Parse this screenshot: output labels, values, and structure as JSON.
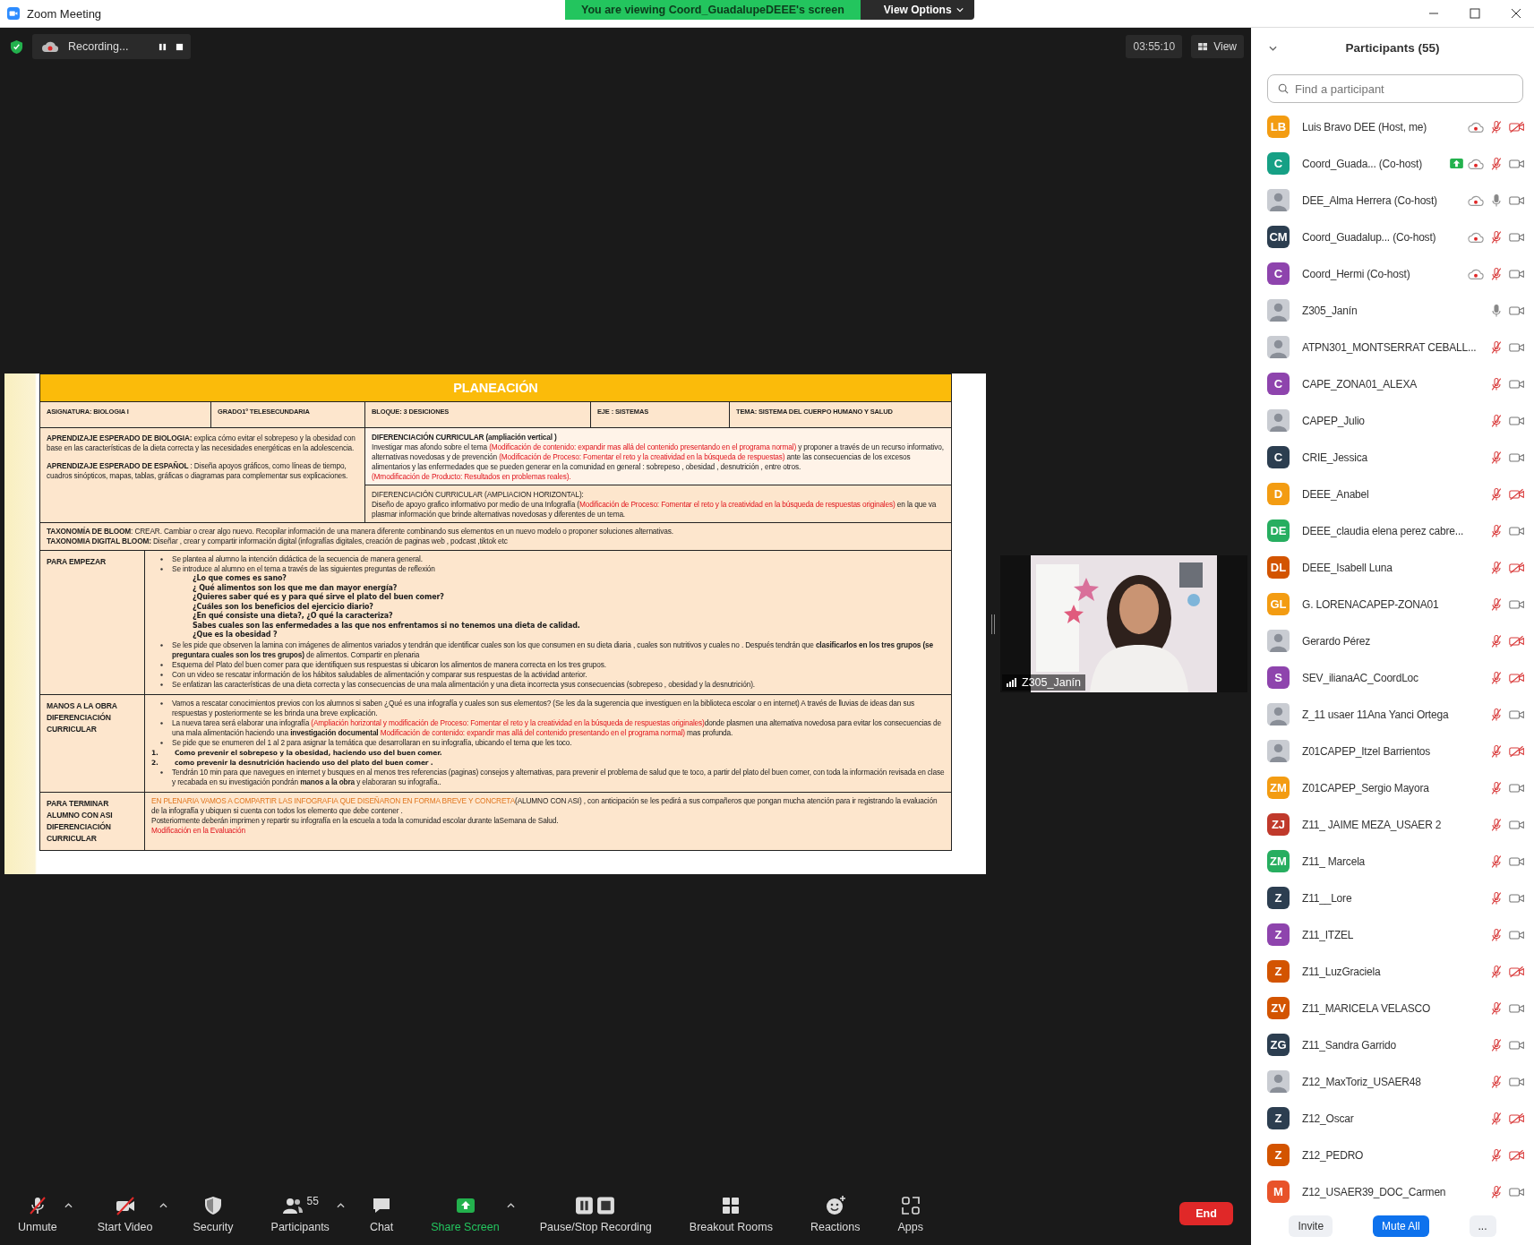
{
  "window": {
    "title": "Zoom Meeting"
  },
  "banner": {
    "text": "You are viewing Coord_GuadalupeDEEE's screen",
    "options": "View Options"
  },
  "top_bar": {
    "recording": "Recording...",
    "timer": "03:55:10",
    "view": "View"
  },
  "document": {
    "title": "PLANEACIÓN",
    "info": [
      "ASIGNATURA: BIOLOGIA I",
      "GRADO1º TELESECUNDARIA",
      "BLOQUE: 3  DESICIONES",
      "EJE : SISTEMAS",
      "TEMA: SISTEMA DEL CUERPO HUMANO Y SALUD"
    ],
    "left_block": [
      {
        "segments": [
          {
            "kind": "plain",
            "text": "**APRENDIZAJE ESPERADO DE BIOLOGIA:** explica cómo evitar el sobrepeso y la obesidad con base en las características de la dieta correcta y las necesidades energéticas en la adolescencia."
          }
        ]
      },
      {
        "segments": [
          {
            "kind": "plain",
            "text": "**APRENDIZAJE ESPERADO DE ESPAÑOL** : Diseña apoyos gráficos, como líneas de tiempo, cuadros sinópticos, mapas, tablas, gráficas o diagramas para complementar sus explicaciones."
          }
        ]
      }
    ],
    "right_blocks": [
      [
        {
          "segments": [
            {
              "kind": "plain",
              "text": "**DIFERENCIACIÓN CURRICULAR (ampliación vertical )**"
            }
          ]
        },
        {
          "segments": [
            {
              "kind": "plain",
              "text": "Investigar mas afondo sobre el tema "
            },
            {
              "kind": "red",
              "text": "(Modificación de contenido: expandir mas allá del contenido presentando en el programa normal)"
            },
            {
              "kind": "plain",
              "text": " y proponer  a través de un recurso informativo, alternativas novedosas y de prevención  "
            },
            {
              "kind": "red",
              "text": "(Modificación de Proceso: Fomentar el reto y la creatividad en la búsqueda de respuestas)"
            },
            {
              "kind": "plain",
              "text": "  ante las consecuencias de los excesos alimentarios  y las enfermedades que se pueden generar en la comunidad en general  : sobrepeso , obesidad , desnutrición , entre otros."
            }
          ]
        },
        {
          "segments": [
            {
              "kind": "red",
              "text": "(Mmodificación de Producto: Resultados en problemas reales)."
            }
          ]
        }
      ],
      [
        {
          "segments": [
            {
              "kind": "plain",
              "text": "DIFERENCIACIÓN CURRICULAR (AMPLIACION HORIZONTAL):"
            }
          ]
        },
        {
          "segments": [
            {
              "kind": "plain",
              "text": "Diseño de apoyo grafico informativo por medio de una Infografía ("
            },
            {
              "kind": "red",
              "text": "Modificación de Proceso: Fomentar el reto y la creatividad en la búsqueda de respuestas originales)"
            },
            {
              "kind": "plain",
              "text": " en la que va  plasmar información  que brinde  alternativas novedosas y diferentes de un tema."
            }
          ]
        }
      ]
    ],
    "taxonomy": [
      "**TAXONOMÍA DE BLOOM**: CREAR. Cambiar o crear algo nuevo. Recopilar información de una manera diferente combinando sus elementos en un nuevo modelo o proponer soluciones alternativas.",
      "**TAXONOMIA DIGITAL BLOOM:** Diseñar , crear  y compartir información digital (infografías digitales, creación de paginas web , podcast ,tiktok etc"
    ],
    "sections": [
      {
        "label": [
          "PARA EMPEZAR"
        ],
        "items": [
          {
            "kind": "bullet",
            "segments": [
              {
                "kind": "plain",
                "text": "Se plantea al alumno la intención didáctica de la secuencia de manera general."
              }
            ]
          },
          {
            "kind": "bullet",
            "segments": [
              {
                "kind": "plain",
                "text": "Se introduce  al alumno en el  tema a través de las siguientes  preguntas de reflexión"
              }
            ]
          },
          {
            "kind": "question",
            "segments": [
              {
                "kind": "plain",
                "text": "¿Lo que comes es sano?"
              }
            ]
          },
          {
            "kind": "question",
            "segments": [
              {
                "kind": "plain",
                "text": "¿ Qué alimentos son los que me dan mayor energía?"
              }
            ]
          },
          {
            "kind": "question",
            "segments": [
              {
                "kind": "plain",
                "text": "¿Quieres saber qué es y para qué sirve el plato del buen comer?"
              }
            ]
          },
          {
            "kind": "question",
            "segments": [
              {
                "kind": "plain",
                "text": "¿Cuáles son los beneficios del ejercicio diario?"
              }
            ]
          },
          {
            "kind": "question",
            "segments": [
              {
                "kind": "plain",
                "text": "¿En qué consiste una dieta?, ¿O qué la caracteriza?"
              }
            ]
          },
          {
            "kind": "question",
            "segments": [
              {
                "kind": "plain",
                "text": "Sabes cuales son las enfermedades a las que nos enfrentamos si no tenemos una dieta de calidad."
              }
            ]
          },
          {
            "kind": "question",
            "segments": [
              {
                "kind": "plain",
                "text": "¿Que es la obesidad ?"
              }
            ]
          },
          {
            "kind": "bullet",
            "segments": [
              {
                "kind": "plain",
                "text": "Se les pide que observen la lamina con imágenes de alimentos variados y tendrán que identificar cuales son los  que consumen en su dieta diaria , cuales son nutritivos y cuales no . Después tendrán que **clasificarlos en los tres grupos (se preguntara cuales son los tres grupos)** de alimentos. Compartir en plenaria"
              }
            ]
          },
          {
            "kind": "bullet",
            "segments": [
              {
                "kind": "plain",
                "text": "Esquema del Plato del buen comer para que identifiquen sus respuestas  si ubicaron los alimentos de manera correcta en los tres grupos."
              }
            ]
          },
          {
            "kind": "bullet",
            "segments": [
              {
                "kind": "plain",
                "text": "Con un  video se rescatar información de los hábitos saludables de alimentación  y comparar sus respuestas de la actividad anterior."
              }
            ]
          },
          {
            "kind": "bullet",
            "segments": [
              {
                "kind": "plain",
                "text": "Se enfatizan las características de una dieta correcta y las consecuencias de una mala alimentación y una dieta incorrecta  ysus consecuencias (sobrepeso , obesidad y la desnutrición)."
              }
            ]
          }
        ]
      },
      {
        "label": [
          "MANOS A LA OBRA",
          "DIFERENCIACIÓN",
          "CURRICULAR"
        ],
        "items": [
          {
            "kind": "bullet",
            "segments": [
              {
                "kind": "plain",
                "text": "Vamos a rescatar conocimientos previos con  los alumnos  si saben ¿Qué es una infografía y cuales son sus elementos? (Se les da la sugerencia que investiguen  en  la biblioteca escolar  o en internet)  A través de lluvias de ideas dan sus respuestas y posteriormente se les brinda  una breve explicación."
              }
            ]
          },
          {
            "kind": "bullet",
            "segments": [
              {
                "kind": "plain",
                "text": "La nueva tarea será  elaborar una infografía "
              },
              {
                "kind": "red",
                "text": "(Ampliación horizontal y modificación de Proceso: Fomentar el reto y la creatividad en la búsqueda de respuestas originales)"
              },
              {
                "kind": "plain",
                "text": "donde plasmen una alternativa novedosa para evitar los consecuencias de una mala alimentación haciendo una **investigación documental** "
              },
              {
                "kind": "red",
                "text": "Modificación de contenido: expandir mas allá del contenido presentando en el programa normal)"
              },
              {
                "kind": "plain",
                "text": " mas profunda."
              }
            ]
          },
          {
            "kind": "bullet",
            "segments": [
              {
                "kind": "plain",
                "text": "Se  pide que se enumeren del 1 al 2 para asignar  la temática que desarrollaran en su infografía, ubicando el tema que les toco."
              }
            ]
          },
          {
            "kind": "numbered",
            "number": "1.",
            "segments": [
              {
                "kind": "plain",
                "text": "Como prevenir el sobrepeso y la obesidad, haciendo uso del buen comer."
              }
            ]
          },
          {
            "kind": "numbered",
            "number": "2.",
            "segments": [
              {
                "kind": "plain",
                "text": "como prevenir la desnutrición haciendo uso del plato del  buen comer ."
              }
            ]
          },
          {
            "kind": "bullet",
            "segments": [
              {
                "kind": "plain",
                "text": "Tendrán  10 min para que navegues en internet  y busques en al menos tres referencias (paginas) consejos y alternativas,  para prevenir el problema de salud que te toco, a partir del plato del  buen comer, con toda la información revisada en clase y  recabada  en su investigación pondrán **manos a la obra** y elaboraran su infografía.."
              }
            ]
          }
        ]
      },
      {
        "label": [
          "PARA TERMINAR",
          "ALUMNO CON ASI",
          "DIFERENCIACIÓN",
          "CURRICULAR"
        ],
        "items": [
          {
            "kind": "para",
            "segments": [
              {
                "kind": "orange",
                "text": "EN PLENARIA VAMOS A COMPARTIR LAS INFOGRAFIA QUE DISEÑARON EN FORMA BREVE Y CONCRETA"
              },
              {
                "kind": "plain",
                "text": "(ALUMNO CON ASI)  , con anticipación se les pedirá a sus compañeros que pongan mucha atención para ir registrando  la evaluación de la  infografía y ubiquen si cuenta  con todos los elemento que debe contener ."
              }
            ]
          },
          {
            "kind": "para",
            "segments": [
              {
                "kind": "plain",
                "text": "Posteriormente deberán  imprimen y repartir  su infografía  en la escuela a toda la comunidad escolar  durante laSemana de Salud."
              }
            ]
          },
          {
            "kind": "para",
            "segments": [
              {
                "kind": "red",
                "text": "Modificación en la Evaluación"
              }
            ]
          }
        ]
      }
    ]
  },
  "video_tile": {
    "kind": "picture",
    "name": "Z305_Janín"
  },
  "toolbar": [
    {
      "kind": "mic",
      "label": "Unmute",
      "caret": true
    },
    {
      "kind": "video",
      "label": "Start Video",
      "caret": true
    },
    {
      "kind": "security",
      "label": "Security",
      "caret": false
    },
    {
      "kind": "participants",
      "label": "Participants",
      "count": "55",
      "caret": true
    },
    {
      "kind": "chat",
      "label": "Chat",
      "caret": false
    },
    {
      "kind": "share",
      "label": "Share Screen",
      "caret": true
    },
    {
      "kind": "record",
      "label": "Pause/Stop Recording",
      "caret": false
    },
    {
      "kind": "breakout",
      "label": "Breakout Rooms",
      "caret": false
    },
    {
      "kind": "reactions",
      "label": "Reactions",
      "caret": false
    },
    {
      "kind": "apps",
      "label": "Apps",
      "caret": false
    }
  ],
  "end_button": "End",
  "participants": {
    "title": "Participants (55)",
    "search": {
      "placeholder": "Find a participant"
    },
    "list": [
      {
        "avatar": {
          "kind": "initials",
          "initials": "LB",
          "color": "#f39c12"
        },
        "name": "Luis Bravo DEE (Host, me)",
        "recording": true,
        "sharing": false,
        "muted": true,
        "video_off": true
      },
      {
        "avatar": {
          "kind": "initials",
          "initials": "C",
          "color": "#16a085"
        },
        "name": "Coord_Guada... (Co-host)",
        "recording": true,
        "sharing": true,
        "muted": true,
        "video_off": false
      },
      {
        "name": "DEE_Alma Herrera (Co-host)",
        "recording": true,
        "sharing": false,
        "muted": false,
        "video_off": false
      },
      {
        "avatar": {
          "kind": "initials",
          "initials": "CM",
          "color": "#2c3e50"
        },
        "name": "Coord_Guadalup...   (Co-host)",
        "recording": true,
        "sharing": false,
        "muted": true,
        "video_off": false
      },
      {
        "avatar": {
          "kind": "initials",
          "initials": "C",
          "color": "#8e44ad"
        },
        "name": "Coord_Hermi (Co-host)",
        "recording": true,
        "sharing": false,
        "muted": true,
        "video_off": false
      },
      {
        "name": "Z305_Janín",
        "recording": false,
        "sharing": false,
        "muted": false,
        "video_off": false
      },
      {
        "name": "ATPN301_MONTSERRAT CEBALL...",
        "recording": false,
        "sharing": false,
        "muted": true,
        "video_off": false
      },
      {
        "avatar": {
          "kind": "initials",
          "initials": "C",
          "color": "#8e44ad"
        },
        "name": "CAPE_ZONA01_ALEXA",
        "recording": false,
        "sharing": false,
        "muted": true,
        "video_off": false
      },
      {
        "name": "CAPEP_Julio",
        "recording": false,
        "sharing": false,
        "muted": true,
        "video_off": false
      },
      {
        "avatar": {
          "kind": "initials",
          "initials": "C",
          "color": "#2c3e50"
        },
        "name": "CRIE_Jessica",
        "recording": false,
        "sharing": false,
        "muted": true,
        "video_off": false
      },
      {
        "avatar": {
          "kind": "initials",
          "initials": "D",
          "color": "#f39c12"
        },
        "name": "DEEE_Anabel",
        "recording": false,
        "sharing": false,
        "muted": true,
        "video_off": true
      },
      {
        "avatar": {
          "kind": "initials",
          "initials": "DE",
          "color": "#27ae60"
        },
        "name": "DEEE_claudia elena perez cabre...",
        "recording": false,
        "sharing": false,
        "muted": true,
        "video_off": false
      },
      {
        "avatar": {
          "kind": "initials",
          "initials": "DL",
          "color": "#d35400"
        },
        "name": "DEEE_Isabell Luna",
        "recording": false,
        "sharing": false,
        "muted": true,
        "video_off": true
      },
      {
        "avatar": {
          "kind": "initials",
          "initials": "GL",
          "color": "#f39c12"
        },
        "name": "G. LORENACAPEP-ZONA01",
        "recording": false,
        "sharing": false,
        "muted": true,
        "video_off": false
      },
      {
        "name": "Gerardo Pérez",
        "recording": false,
        "sharing": false,
        "muted": true,
        "video_off": true
      },
      {
        "avatar": {
          "kind": "initials",
          "initials": "S",
          "color": "#8e44ad"
        },
        "name": "SEV_ilianaAC_CoordLoc",
        "recording": false,
        "sharing": false,
        "muted": true,
        "video_off": true
      },
      {
        "name": "Z_11 usaer 11Ana Yanci Ortega",
        "recording": false,
        "sharing": false,
        "muted": true,
        "video_off": false
      },
      {
        "name": "Z01CAPEP_Itzel Barrientos",
        "recording": false,
        "sharing": false,
        "muted": true,
        "video_off": true
      },
      {
        "avatar": {
          "kind": "initials",
          "initials": "ZM",
          "color": "#f39c12"
        },
        "name": "Z01CAPEP_Sergio Mayora",
        "recording": false,
        "sharing": false,
        "muted": true,
        "video_off": false
      },
      {
        "avatar": {
          "kind": "initials",
          "initials": "ZJ",
          "color": "#c0392b"
        },
        "name": "Z11_ JAIME MEZA_USAER 2",
        "recording": false,
        "sharing": false,
        "muted": true,
        "video_off": false
      },
      {
        "avatar": {
          "kind": "initials",
          "initials": "ZM",
          "color": "#27ae60"
        },
        "name": "Z11_ Marcela",
        "recording": false,
        "sharing": false,
        "muted": true,
        "video_off": false
      },
      {
        "avatar": {
          "kind": "initials",
          "initials": "Z",
          "color": "#2c3e50"
        },
        "name": "Z11__Lore",
        "recording": false,
        "sharing": false,
        "muted": true,
        "video_off": false
      },
      {
        "avatar": {
          "kind": "initials",
          "initials": "Z",
          "color": "#8e44ad"
        },
        "name": "Z11_ITZEL",
        "recording": false,
        "sharing": false,
        "muted": true,
        "video_off": false
      },
      {
        "avatar": {
          "kind": "initials",
          "initials": "Z",
          "color": "#d35400"
        },
        "name": "Z11_LuzGraciela",
        "recording": false,
        "sharing": false,
        "muted": true,
        "video_off": true
      },
      {
        "avatar": {
          "kind": "initials",
          "initials": "ZV",
          "color": "#d35400"
        },
        "name": "Z11_MARICELA VELASCO",
        "recording": false,
        "sharing": false,
        "muted": true,
        "video_off": false
      },
      {
        "avatar": {
          "kind": "initials",
          "initials": "ZG",
          "color": "#2c3e50"
        },
        "name": "Z11_Sandra Garrido",
        "recording": false,
        "sharing": false,
        "muted": true,
        "video_off": false
      },
      {
        "name": "Z12_MaxToriz_USAER48",
        "recording": false,
        "sharing": false,
        "muted": true,
        "video_off": false
      },
      {
        "avatar": {
          "kind": "initials",
          "initials": "Z",
          "color": "#2c3e50"
        },
        "name": "Z12_Oscar",
        "recording": false,
        "sharing": false,
        "muted": true,
        "video_off": true
      },
      {
        "avatar": {
          "kind": "initials",
          "initials": "Z",
          "color": "#d35400"
        },
        "name": "Z12_PEDRO",
        "recording": false,
        "sharing": false,
        "muted": true,
        "video_off": true
      },
      {
        "avatar": {
          "kind": "initials",
          "initials": "M",
          "color": "#e8532a"
        },
        "name": "Z12_USAER39_DOC_Carmen",
        "recording": false,
        "sharing": false,
        "muted": true,
        "video_off": false
      }
    ],
    "buttons": [
      {
        "kind": "plain",
        "label": "Invite"
      },
      {
        "kind": "primary",
        "label": "Mute All"
      },
      {
        "kind": "plain",
        "label": "..."
      }
    ]
  }
}
